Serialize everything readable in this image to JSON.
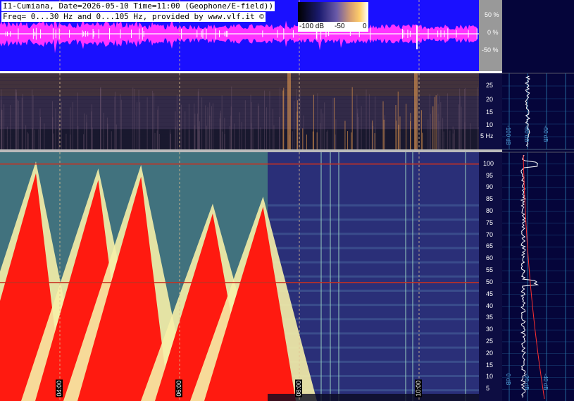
{
  "header": {
    "line1": "I1-Cumiana, Date=2026-05-10 Time=11:00 (Geophone/E-field))",
    "line2": "Freq= 0...30 Hz and 0...105 Hz, provided by www.vlf.it ©"
  },
  "colorbar": {
    "labels": [
      "-100 dB",
      "-50",
      "0"
    ]
  },
  "chart_data": [
    {
      "type": "line",
      "title": "",
      "ylabel": "",
      "yticks": [
        "50 %",
        "0 %",
        "-50 %"
      ],
      "ylim": [
        -100,
        100
      ],
      "colors": {
        "background": "#1a10ff",
        "trace": "#ff33ff",
        "spike": "#ffffff"
      }
    },
    {
      "type": "heatmap",
      "title": "",
      "ylim": [
        0,
        30
      ],
      "yticks": [
        25,
        20,
        15,
        10
      ],
      "ytick_last": "5 Hz",
      "colors": {
        "low": "#1a1a3a",
        "high": "#f0a050"
      }
    },
    {
      "type": "heatmap",
      "title": "",
      "ylim": [
        0,
        105
      ],
      "yticks": [
        100,
        95,
        90,
        85,
        80,
        75,
        70,
        65,
        60,
        55,
        50,
        45,
        40,
        35,
        30,
        25,
        20,
        15,
        10,
        5
      ],
      "xticks": [
        "04:00",
        "06:00",
        "08:00",
        "10:00"
      ],
      "xtick_hours": [
        4,
        6,
        8,
        10
      ],
      "xlim_hours": [
        3.0,
        11.0
      ],
      "lines_hz": [
        50,
        100
      ],
      "colors": {
        "red": "#ff1a10",
        "yellow": "#f6f0a8",
        "green": "#5aa07a",
        "blue": "#2a2f78"
      }
    },
    {
      "type": "line",
      "title": "",
      "xticks": [
        "0 dB",
        "-20 dB",
        "-40 dB"
      ],
      "xticks_low": [
        "-100 dB",
        "-80 dB",
        "-60 dB"
      ],
      "colors": {
        "trace": "#ffffff",
        "fit": "#ff3030"
      }
    }
  ]
}
